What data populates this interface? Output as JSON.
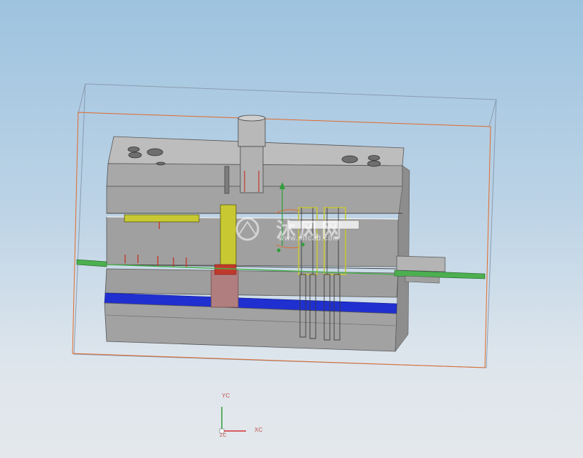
{
  "viewport": {
    "background_top": "#9ec3df",
    "background_bottom": "#e4e8ec"
  },
  "model": {
    "plate_color": "#a3a3a3",
    "plate_top_color": "#bdbdbd",
    "plate_shadow_color": "#8a8a8a",
    "insert_color": "#c8c832",
    "cavity_blue": "#1f2fd0",
    "runner_green": "#4caf50",
    "gate_red": "#c0392b",
    "sprue_color": "#b0b0b0",
    "bounding_box_color": "#e06a2a",
    "bounding_box_outer_color": "#8a9bb0"
  },
  "watermark": {
    "text": "沐风网",
    "url": "www.mfcad.com"
  },
  "triad": {
    "y_label": "YC",
    "x_label": "XC",
    "z_label": "ZC",
    "x_color": "#d32f2f",
    "y_color": "#2e9e3a"
  }
}
